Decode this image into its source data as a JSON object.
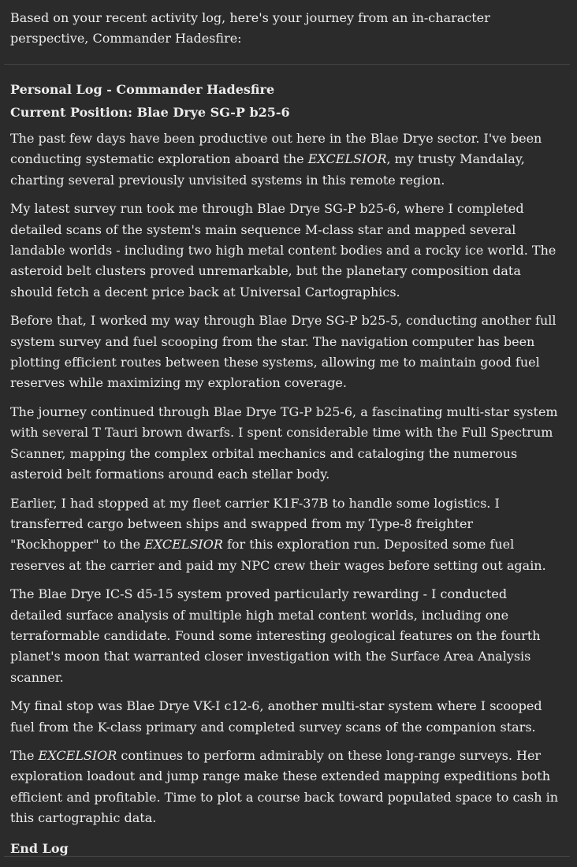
{
  "intro": "Based on your recent activity log, here's your journey from an in-character perspective, Commander Hadesfire:",
  "log": {
    "title": "Personal Log - Commander Hadesfire",
    "position": "Current Position: Blae Drye SG-P b25-6",
    "ship_name": "EXCELSIOR",
    "p1": {
      "a": "The past few days have been productive out here in the Blae Drye sector. I've been conducting systematic exploration aboard the ",
      "b": ", my trusty Mandalay, charting several previously unvisited systems in this remote region."
    },
    "p2": "My latest survey run took me through Blae Drye SG-P b25-6, where I completed detailed scans of the system's main sequence M-class star and mapped several landable worlds - including two high metal content bodies and a rocky ice world. The asteroid belt clusters proved unremarkable, but the planetary composition data should fetch a decent price back at Universal Cartographics.",
    "p3": "Before that, I worked my way through Blae Drye SG-P b25-5, conducting another full system survey and fuel scooping from the star. The navigation computer has been plotting efficient routes between these systems, allowing me to maintain good fuel reserves while maximizing my exploration coverage.",
    "p4": "The journey continued through Blae Drye TG-P b25-6, a fascinating multi-star system with several T Tauri brown dwarfs. I spent considerable time with the Full Spectrum Scanner, mapping the complex orbital mechanics and cataloging the numerous asteroid belt formations around each stellar body.",
    "p5": {
      "a": "Earlier, I had stopped at my fleet carrier K1F-37B to handle some logistics. I transferred cargo between ships and swapped from my Type-8 freighter \"Rockhopper\" to the ",
      "b": " for this exploration run. Deposited some fuel reserves at the carrier and paid my NPC crew their wages before setting out again."
    },
    "p6": "The Blae Drye IC-S d5-15 system proved particularly rewarding - I conducted detailed surface analysis of multiple high metal content worlds, including one terraformable candidate. Found some interesting geological features on the fourth planet's moon that warranted closer investigation with the Surface Area Analysis scanner.",
    "p7": "My final stop was Blae Drye VK-I c12-6, another multi-star system where I scooped fuel from the K-class primary and completed survey scans of the companion stars.",
    "p8": {
      "a": "The ",
      "b": " continues to perform admirably on these long-range surveys. Her exploration loadout and jump range make these extended mapping expeditions both efficient and profitable. Time to plot a course back toward populated space to cash in this cartographic data."
    },
    "end": "End Log"
  }
}
